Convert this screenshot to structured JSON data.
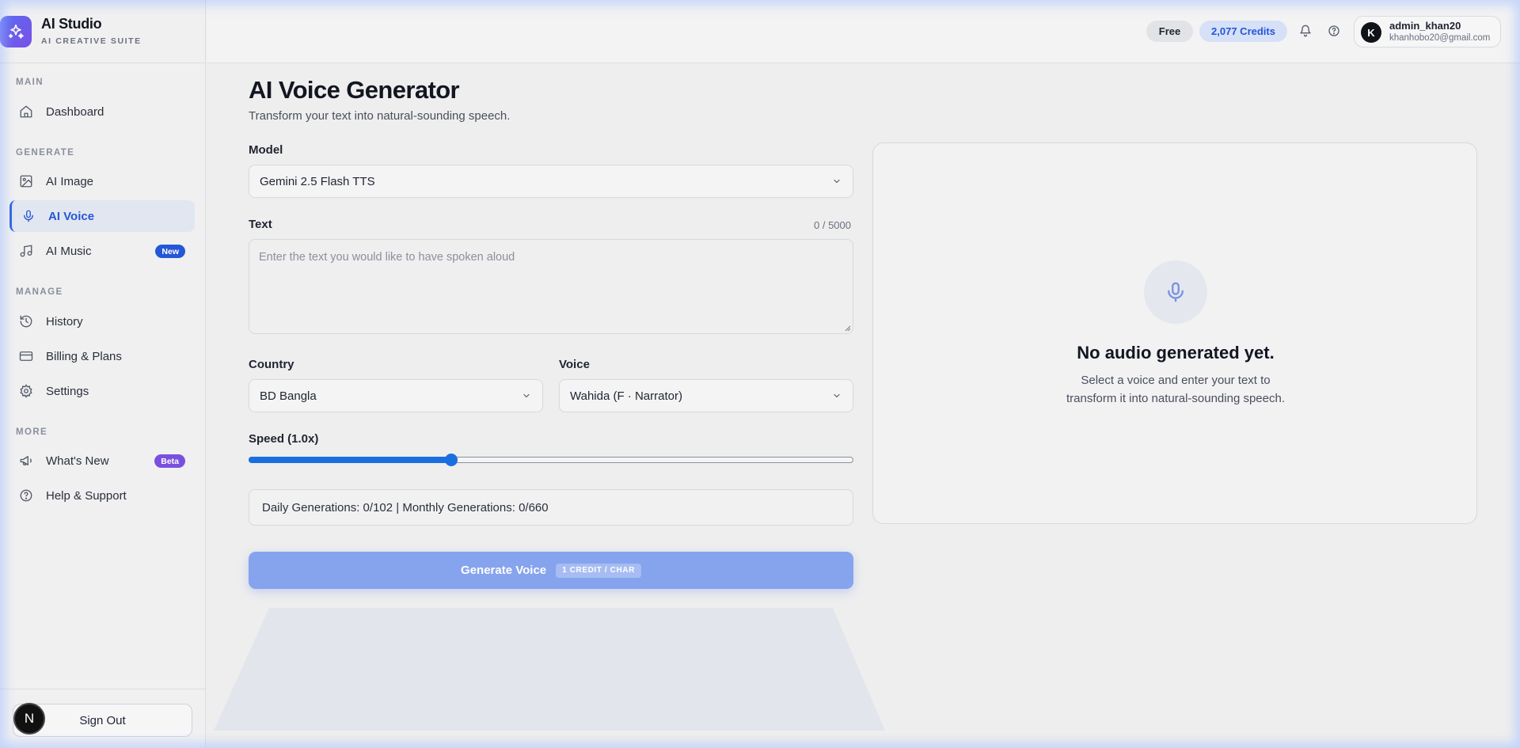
{
  "brand": {
    "title": "AI Studio",
    "subtitle": "AI CREATIVE SUITE"
  },
  "sidebar": {
    "sections": [
      {
        "label": "MAIN"
      },
      {
        "label": "GENERATE"
      },
      {
        "label": "MANAGE"
      },
      {
        "label": "MORE"
      }
    ],
    "items": [
      {
        "label": "Dashboard",
        "icon": "home-icon"
      },
      {
        "label": "AI Image",
        "icon": "image-icon"
      },
      {
        "label": "AI Voice",
        "icon": "mic-icon",
        "active": true
      },
      {
        "label": "AI Music",
        "icon": "music-icon",
        "badge": "New"
      },
      {
        "label": "History",
        "icon": "history-icon"
      },
      {
        "label": "Billing & Plans",
        "icon": "credit-card-icon"
      },
      {
        "label": "Settings",
        "icon": "gear-icon"
      },
      {
        "label": "What's New",
        "icon": "megaphone-icon",
        "badge": "Beta"
      },
      {
        "label": "Help & Support",
        "icon": "help-circle-icon"
      }
    ],
    "signout_label": "Sign Out",
    "avatar_letter": "N"
  },
  "header": {
    "plan_label": "Free",
    "credits_label": "2,077 Credits",
    "user": {
      "initial": "K",
      "name": "admin_khan20",
      "email": "khanhobo20@gmail.com"
    }
  },
  "main": {
    "title": "AI Voice Generator",
    "subtitle": "Transform your text into natural-sounding speech.",
    "model": {
      "label": "Model",
      "value": "Gemini 2.5 Flash TTS"
    },
    "text": {
      "label": "Text",
      "placeholder": "Enter the text you would like to have spoken aloud",
      "counter": "0 / 5000"
    },
    "country": {
      "label": "Country",
      "value": "BD Bangla"
    },
    "voice": {
      "label": "Voice",
      "value": "Wahida (F · Narrator)"
    },
    "speed": {
      "label": "Speed (1.0x)",
      "fraction": 0.335
    },
    "stats": "Daily Generations: 0/102 | Monthly Generations: 0/660",
    "generate": {
      "label": "Generate Voice",
      "tag": "1 CREDIT / CHAR"
    }
  },
  "result": {
    "empty_title": "No audio generated yet.",
    "empty_desc": "Select a voice and enter your text to transform it into natural-sounding speech."
  },
  "colors": {
    "accent": "#2457d6",
    "primary_button": "#86a3ee",
    "beta": "#7a4fe0"
  }
}
